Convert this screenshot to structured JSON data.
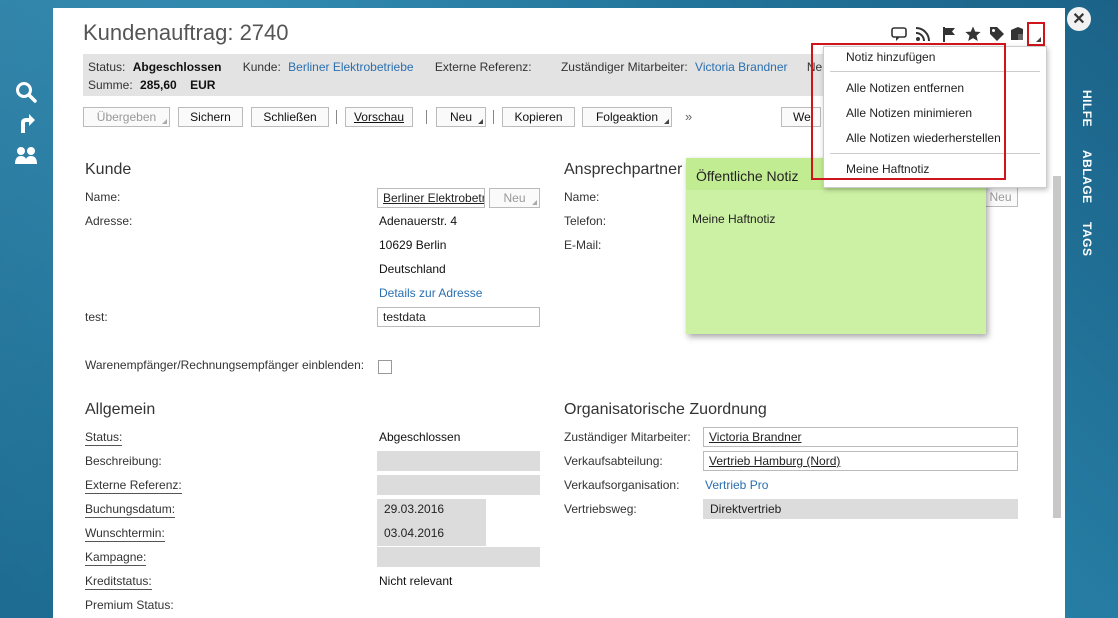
{
  "window": {
    "title": "Kundenauftrag: 2740"
  },
  "left_rail": {
    "icons": [
      "search-icon",
      "share-arrow-icon",
      "users-icon"
    ]
  },
  "right_rail": {
    "tabs": [
      "HILFE",
      "ABLAGE",
      "TAGS"
    ]
  },
  "close_glyph": "✕",
  "top_icons": [
    "comment-icon",
    "rss-icon",
    "flag-icon",
    "star-icon",
    "tag-icon",
    "notes-icon"
  ],
  "infobar": {
    "status_label": "Status:",
    "status_value": "Abgeschlossen",
    "kunde_label": "Kunde:",
    "kunde_value": "Berliner Elektrobetriebe",
    "extref_label": "Externe Referenz:",
    "mitarbeiter_label": "Zuständiger Mitarbeiter:",
    "mitarbeiter_value": "Victoria Brandner",
    "extra_label": "Ne",
    "summe_label": "Summe:",
    "summe_value": "285,60",
    "summe_currency": "EUR"
  },
  "toolbar": {
    "uebergeben": "Übergeben",
    "sichern": "Sichern",
    "schliessen": "Schließen",
    "vorschau": "Vorschau",
    "neu": "Neu",
    "kopieren": "Kopieren",
    "folgeaktion": "Folgeaktion",
    "more": "»",
    "weitere": "We"
  },
  "kunde": {
    "title": "Kunde",
    "name_label": "Name:",
    "name_value": "Berliner Elektrobetriebe",
    "neu_button": "Neu",
    "adresse_label": "Adresse:",
    "street": "Adenauerstr. 4",
    "city": "10629 Berlin",
    "country": "Deutschland",
    "details_link": "Details zur Adresse",
    "test_label": "test:",
    "test_value": "testdata",
    "waren_label": "Warenempfänger/Rechnungsempfänger einblenden:"
  },
  "ansprechpartner": {
    "title": "Ansprechpartner",
    "name_label": "Name:",
    "telefon_label": "Telefon:",
    "email_label": "E-Mail:",
    "neu_button": "Neu"
  },
  "allgemein": {
    "title": "Allgemein",
    "status_label": "Status:",
    "status_value": "Abgeschlossen",
    "beschreibung_label": "Beschreibung:",
    "extref_label": "Externe Referenz:",
    "buchungsdatum_label": "Buchungsdatum:",
    "buchungsdatum_value": "29.03.2016",
    "wunschtermin_label": "Wunschtermin:",
    "wunschtermin_value": "03.04.2016",
    "kampagne_label": "Kampagne:",
    "kreditstatus_label": "Kreditstatus:",
    "kreditstatus_value": "Nicht relevant",
    "premium_label": "Premium Status:"
  },
  "org": {
    "title": "Organisatorische Zuordnung",
    "mitarbeiter_label": "Zuständiger Mitarbeiter:",
    "mitarbeiter_value": "Victoria Brandner",
    "abteilung_label": "Verkaufsabteilung:",
    "abteilung_value": "Vertrieb Hamburg (Nord)",
    "organisation_label": "Verkaufsorganisation:",
    "organisation_value": "Vertrieb Pro",
    "vertriebsweg_label": "Vertriebsweg:",
    "vertriebsweg_value": "Direktvertrieb"
  },
  "note": {
    "title": "Öffentliche Notiz",
    "body": "Meine Haftnotiz"
  },
  "dropdown": {
    "items": [
      "Notiz hinzufügen",
      "Alle Notizen entfernen",
      "Alle Notizen minimieren",
      "Alle Notizen wiederherstellen",
      "Meine Haftnotiz"
    ]
  }
}
